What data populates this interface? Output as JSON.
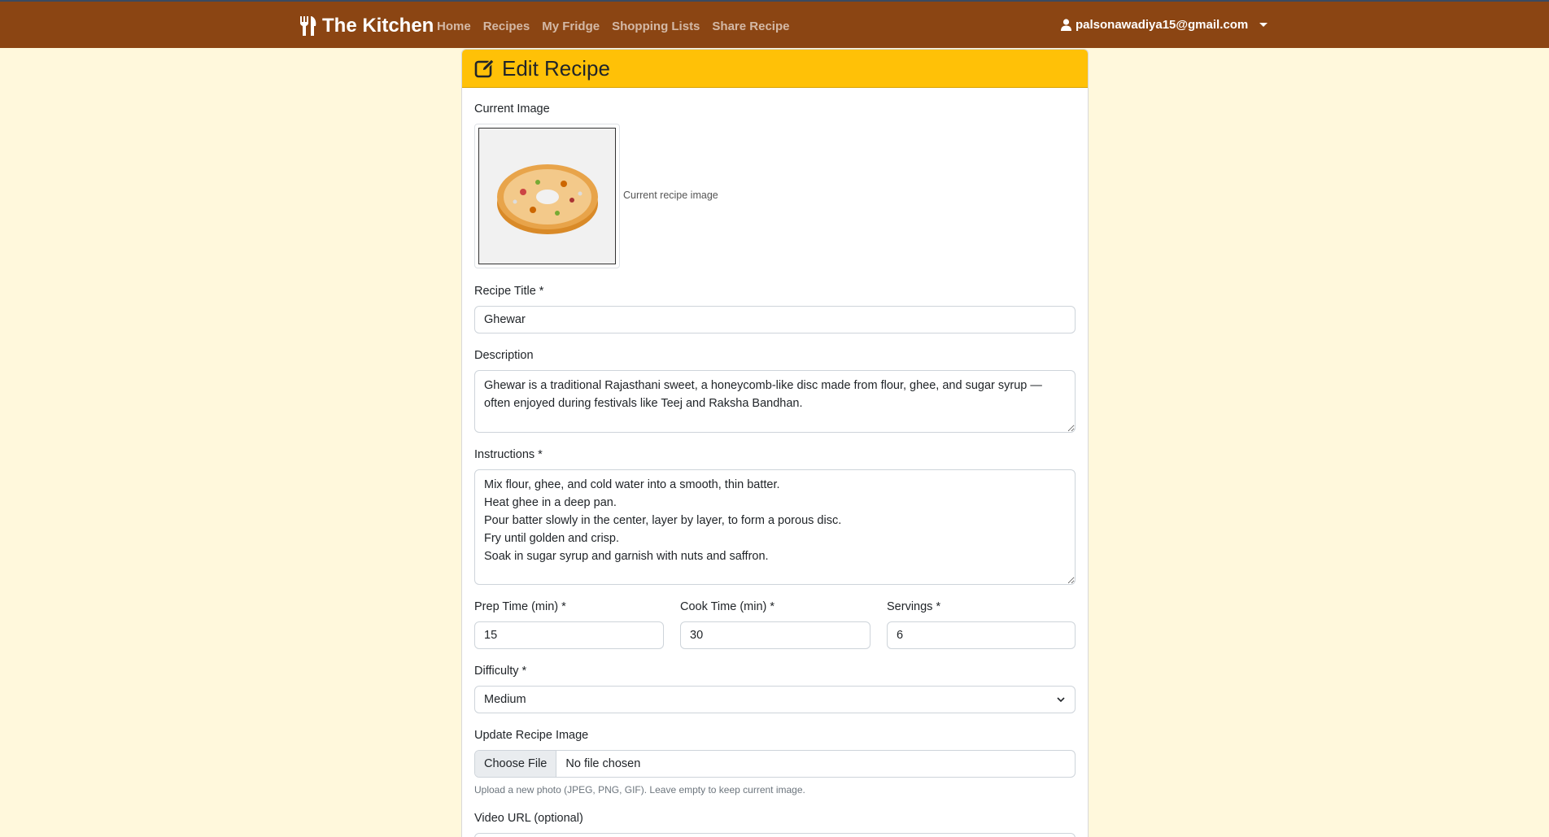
{
  "nav": {
    "brand": "The Kitchen",
    "links": [
      "Home",
      "Recipes",
      "My Fridge",
      "Shopping Lists",
      "Share Recipe"
    ],
    "user_email": "palsonawadiya15@gmail.com"
  },
  "colors": {
    "navbar": "#8b4513",
    "header": "#ffc107",
    "page_bg": "#fff8dc"
  },
  "card": {
    "title": "Edit Recipe",
    "current_image_label": "Current Image",
    "current_image_caption": "Current recipe image",
    "title_label": "Recipe Title *",
    "title_value": "Ghewar",
    "description_label": "Description",
    "description_value": "Ghewar is a traditional Rajasthani sweet, a honeycomb-like disc made from flour, ghee, and sugar syrup — often enjoyed during festivals like Teej and Raksha Bandhan.",
    "instructions_label": "Instructions *",
    "instructions_value": "Mix flour, ghee, and cold water into a smooth, thin batter.\nHeat ghee in a deep pan.\nPour batter slowly in the center, layer by layer, to form a porous disc.\nFry until golden and crisp.\nSoak in sugar syrup and garnish with nuts and saffron.",
    "prep_label": "Prep Time (min) *",
    "prep_value": "15",
    "cook_label": "Cook Time (min) *",
    "cook_value": "30",
    "servings_label": "Servings *",
    "servings_value": "6",
    "difficulty_label": "Difficulty *",
    "difficulty_value": "Medium",
    "update_image_label": "Update Recipe Image",
    "file_button": "Choose File",
    "file_status": "No file chosen",
    "file_help": "Upload a new photo (JPEG, PNG, GIF). Leave empty to keep current image.",
    "video_label": "Video URL (optional)"
  }
}
